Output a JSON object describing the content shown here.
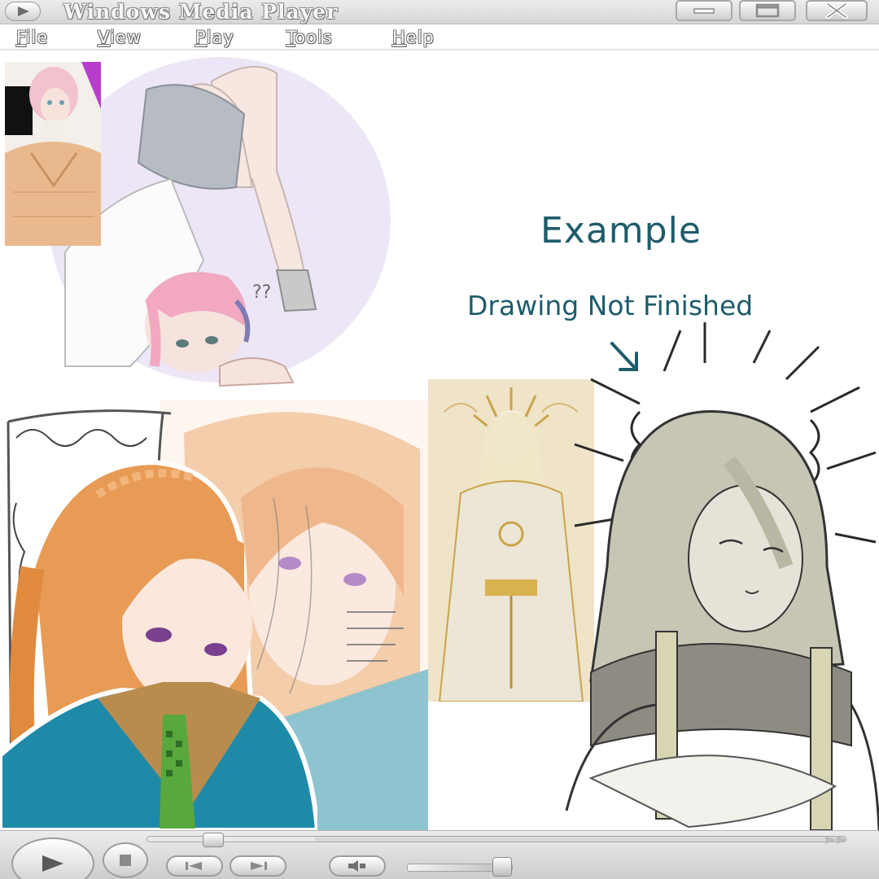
{
  "window": {
    "title": "Windows Media Player",
    "controls": [
      "minimize",
      "maximize",
      "close"
    ]
  },
  "menu": {
    "items": [
      {
        "label": "File"
      },
      {
        "label": "View"
      },
      {
        "label": "Play"
      },
      {
        "label": "Tools"
      },
      {
        "label": "Help"
      }
    ]
  },
  "content": {
    "annotation_title": "Example",
    "annotation_note": "Drawing Not Finished",
    "annotation_arrow_icon": "arrow-down-right-icon",
    "artworks": [
      {
        "name": "pink-haired-boy-in-sweater",
        "colors": [
          "#f2c3cf",
          "#e9b98d",
          "#b73dce"
        ]
      },
      {
        "name": "pink-haired-boy-stretching",
        "colors": [
          "#f1a8c0",
          "#d7cdf2",
          "#b7bcc4"
        ]
      },
      {
        "name": "orange-haired-girl-in-blazer",
        "colors": [
          "#e79b55",
          "#1f8aa8",
          "#59a83d"
        ]
      },
      {
        "name": "faded-orange-haired-girl-portrait",
        "colors": [
          "#f3c9a3",
          "#8ec4cf"
        ]
      },
      {
        "name": "golden-sun-halo-figure",
        "colors": [
          "#e9d7a6",
          "#c9a44a"
        ]
      },
      {
        "name": "unfinished-sun-halo-sketch",
        "colors": [
          "#c7c5b4",
          "#8e8c82",
          "#d8d5b2"
        ]
      }
    ]
  },
  "player": {
    "seek_progress": 0.24,
    "volume": 0.9,
    "icons": {
      "play": "play-icon",
      "stop": "stop-icon",
      "previous": "previous-icon",
      "next": "next-icon",
      "mute": "mute-icon",
      "fast_forward": "fast-forward-icon"
    }
  }
}
